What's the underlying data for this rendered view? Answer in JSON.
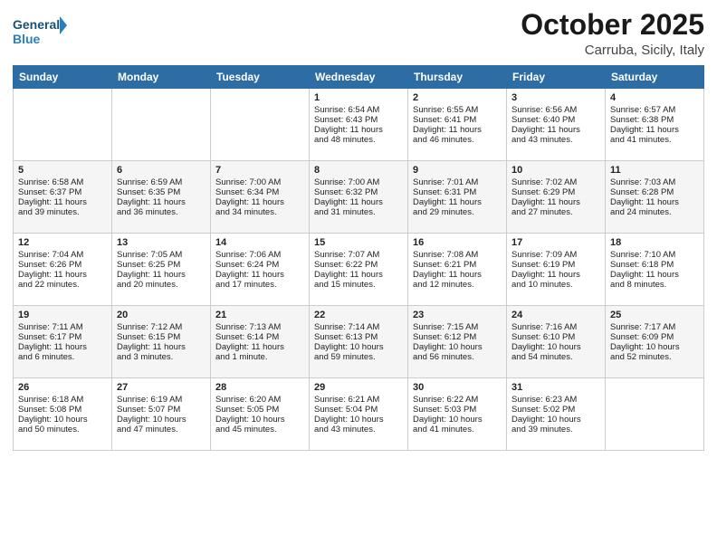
{
  "header": {
    "logo_text_general": "General",
    "logo_text_blue": "Blue",
    "month_title": "October 2025",
    "location": "Carruba, Sicily, Italy"
  },
  "days_of_week": [
    "Sunday",
    "Monday",
    "Tuesday",
    "Wednesday",
    "Thursday",
    "Friday",
    "Saturday"
  ],
  "weeks": [
    [
      {
        "day": "",
        "info": ""
      },
      {
        "day": "",
        "info": ""
      },
      {
        "day": "",
        "info": ""
      },
      {
        "day": "1",
        "info": "Sunrise: 6:54 AM\nSunset: 6:43 PM\nDaylight: 11 hours\nand 48 minutes."
      },
      {
        "day": "2",
        "info": "Sunrise: 6:55 AM\nSunset: 6:41 PM\nDaylight: 11 hours\nand 46 minutes."
      },
      {
        "day": "3",
        "info": "Sunrise: 6:56 AM\nSunset: 6:40 PM\nDaylight: 11 hours\nand 43 minutes."
      },
      {
        "day": "4",
        "info": "Sunrise: 6:57 AM\nSunset: 6:38 PM\nDaylight: 11 hours\nand 41 minutes."
      }
    ],
    [
      {
        "day": "5",
        "info": "Sunrise: 6:58 AM\nSunset: 6:37 PM\nDaylight: 11 hours\nand 39 minutes."
      },
      {
        "day": "6",
        "info": "Sunrise: 6:59 AM\nSunset: 6:35 PM\nDaylight: 11 hours\nand 36 minutes."
      },
      {
        "day": "7",
        "info": "Sunrise: 7:00 AM\nSunset: 6:34 PM\nDaylight: 11 hours\nand 34 minutes."
      },
      {
        "day": "8",
        "info": "Sunrise: 7:00 AM\nSunset: 6:32 PM\nDaylight: 11 hours\nand 31 minutes."
      },
      {
        "day": "9",
        "info": "Sunrise: 7:01 AM\nSunset: 6:31 PM\nDaylight: 11 hours\nand 29 minutes."
      },
      {
        "day": "10",
        "info": "Sunrise: 7:02 AM\nSunset: 6:29 PM\nDaylight: 11 hours\nand 27 minutes."
      },
      {
        "day": "11",
        "info": "Sunrise: 7:03 AM\nSunset: 6:28 PM\nDaylight: 11 hours\nand 24 minutes."
      }
    ],
    [
      {
        "day": "12",
        "info": "Sunrise: 7:04 AM\nSunset: 6:26 PM\nDaylight: 11 hours\nand 22 minutes."
      },
      {
        "day": "13",
        "info": "Sunrise: 7:05 AM\nSunset: 6:25 PM\nDaylight: 11 hours\nand 20 minutes."
      },
      {
        "day": "14",
        "info": "Sunrise: 7:06 AM\nSunset: 6:24 PM\nDaylight: 11 hours\nand 17 minutes."
      },
      {
        "day": "15",
        "info": "Sunrise: 7:07 AM\nSunset: 6:22 PM\nDaylight: 11 hours\nand 15 minutes."
      },
      {
        "day": "16",
        "info": "Sunrise: 7:08 AM\nSunset: 6:21 PM\nDaylight: 11 hours\nand 12 minutes."
      },
      {
        "day": "17",
        "info": "Sunrise: 7:09 AM\nSunset: 6:19 PM\nDaylight: 11 hours\nand 10 minutes."
      },
      {
        "day": "18",
        "info": "Sunrise: 7:10 AM\nSunset: 6:18 PM\nDaylight: 11 hours\nand 8 minutes."
      }
    ],
    [
      {
        "day": "19",
        "info": "Sunrise: 7:11 AM\nSunset: 6:17 PM\nDaylight: 11 hours\nand 6 minutes."
      },
      {
        "day": "20",
        "info": "Sunrise: 7:12 AM\nSunset: 6:15 PM\nDaylight: 11 hours\nand 3 minutes."
      },
      {
        "day": "21",
        "info": "Sunrise: 7:13 AM\nSunset: 6:14 PM\nDaylight: 11 hours\nand 1 minute."
      },
      {
        "day": "22",
        "info": "Sunrise: 7:14 AM\nSunset: 6:13 PM\nDaylight: 10 hours\nand 59 minutes."
      },
      {
        "day": "23",
        "info": "Sunrise: 7:15 AM\nSunset: 6:12 PM\nDaylight: 10 hours\nand 56 minutes."
      },
      {
        "day": "24",
        "info": "Sunrise: 7:16 AM\nSunset: 6:10 PM\nDaylight: 10 hours\nand 54 minutes."
      },
      {
        "day": "25",
        "info": "Sunrise: 7:17 AM\nSunset: 6:09 PM\nDaylight: 10 hours\nand 52 minutes."
      }
    ],
    [
      {
        "day": "26",
        "info": "Sunrise: 6:18 AM\nSunset: 5:08 PM\nDaylight: 10 hours\nand 50 minutes."
      },
      {
        "day": "27",
        "info": "Sunrise: 6:19 AM\nSunset: 5:07 PM\nDaylight: 10 hours\nand 47 minutes."
      },
      {
        "day": "28",
        "info": "Sunrise: 6:20 AM\nSunset: 5:05 PM\nDaylight: 10 hours\nand 45 minutes."
      },
      {
        "day": "29",
        "info": "Sunrise: 6:21 AM\nSunset: 5:04 PM\nDaylight: 10 hours\nand 43 minutes."
      },
      {
        "day": "30",
        "info": "Sunrise: 6:22 AM\nSunset: 5:03 PM\nDaylight: 10 hours\nand 41 minutes."
      },
      {
        "day": "31",
        "info": "Sunrise: 6:23 AM\nSunset: 5:02 PM\nDaylight: 10 hours\nand 39 minutes."
      },
      {
        "day": "",
        "info": ""
      }
    ]
  ]
}
